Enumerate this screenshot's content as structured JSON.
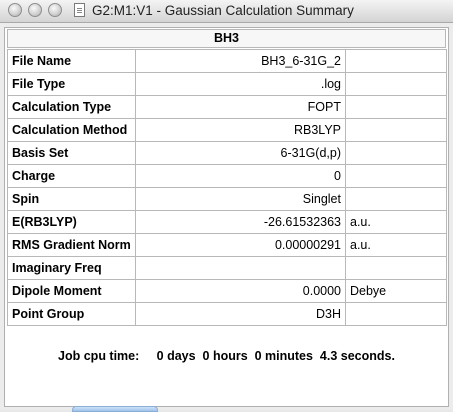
{
  "window": {
    "title": "G2:M1:V1 - Gaussian Calculation Summary"
  },
  "summary": {
    "header": "BH3",
    "rows": [
      {
        "label": "File Name",
        "value": "BH3_6-31G_2",
        "unit": ""
      },
      {
        "label": "File Type",
        "value": ".log",
        "unit": ""
      },
      {
        "label": "Calculation Type",
        "value": "FOPT",
        "unit": ""
      },
      {
        "label": "Calculation Method",
        "value": "RB3LYP",
        "unit": ""
      },
      {
        "label": "Basis Set",
        "value": "6-31G(d,p)",
        "unit": ""
      },
      {
        "label": "Charge",
        "value": "0",
        "unit": ""
      },
      {
        "label": "Spin",
        "value": "Singlet",
        "unit": ""
      },
      {
        "label": "E(RB3LYP)",
        "value": "-26.61532363",
        "unit": "a.u."
      },
      {
        "label": "RMS Gradient Norm",
        "value": "0.00000291",
        "unit": "a.u."
      },
      {
        "label": "Imaginary Freq",
        "value": "",
        "unit": ""
      },
      {
        "label": "Dipole Moment",
        "value": "0.0000",
        "unit": "Debye"
      },
      {
        "label": "Point Group",
        "value": "D3H",
        "unit": ""
      }
    ],
    "cpu_time": "Job cpu time:     0 days  0 hours  0 minutes  4.3 seconds."
  }
}
